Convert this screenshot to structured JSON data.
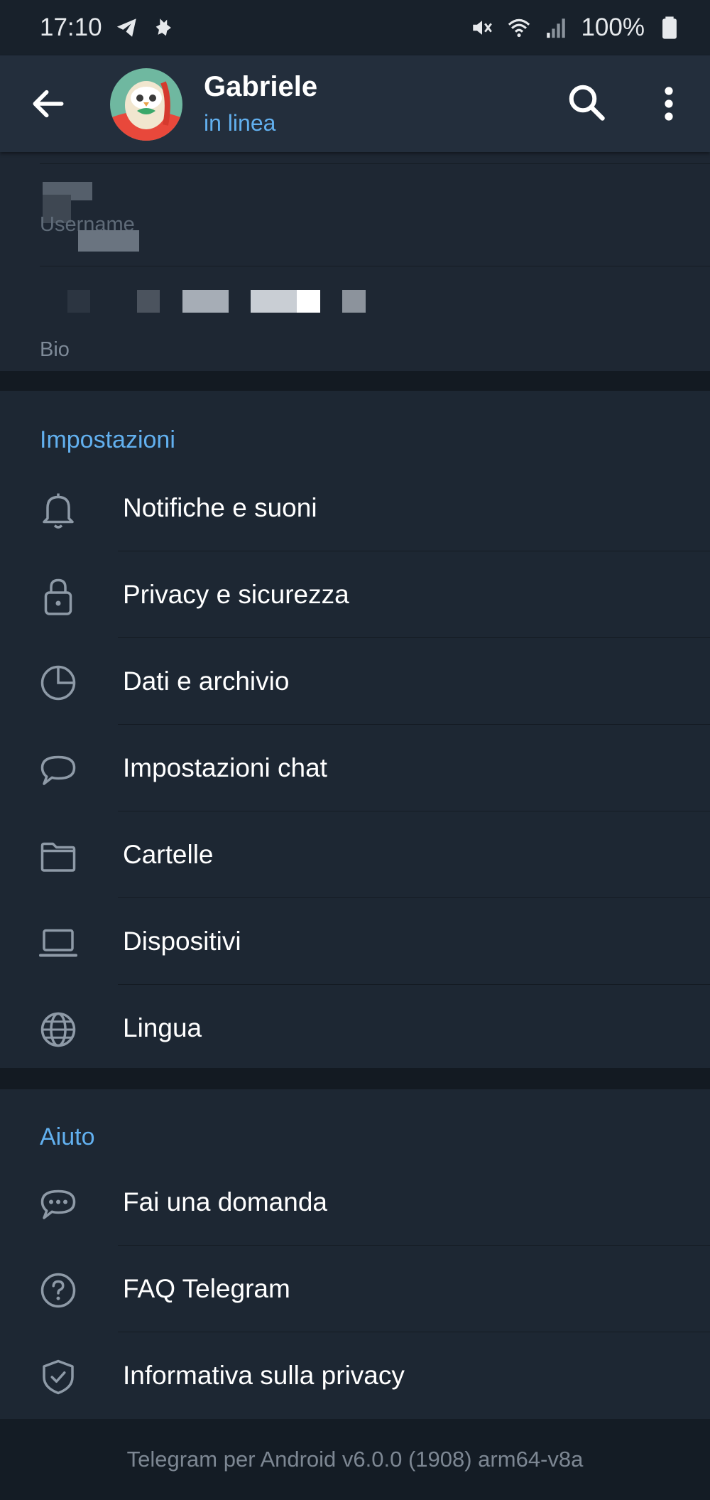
{
  "status_bar": {
    "time": "17:10",
    "battery": "100%"
  },
  "header": {
    "name": "Gabriele",
    "status": "in linea"
  },
  "profile_info": {
    "username_label": "Username",
    "bio_label": "Bio"
  },
  "settings_section": {
    "title": "Impostazioni",
    "items": [
      {
        "label": "Notifiche e suoni",
        "icon": "bell-icon"
      },
      {
        "label": "Privacy e sicurezza",
        "icon": "lock-icon"
      },
      {
        "label": "Dati e archivio",
        "icon": "pie-chart-icon"
      },
      {
        "label": "Impostazioni chat",
        "icon": "chat-bubble-icon"
      },
      {
        "label": "Cartelle",
        "icon": "folder-icon"
      },
      {
        "label": "Dispositivi",
        "icon": "laptop-icon"
      },
      {
        "label": "Lingua",
        "icon": "globe-icon"
      }
    ]
  },
  "help_section": {
    "title": "Aiuto",
    "items": [
      {
        "label": "Fai una domanda",
        "icon": "chat-dots-icon"
      },
      {
        "label": "FAQ Telegram",
        "icon": "question-icon"
      },
      {
        "label": "Informativa sulla privacy",
        "icon": "shield-check-icon"
      }
    ]
  },
  "footer": {
    "version": "Telegram per Android v6.0.0 (1908) arm64-v8a"
  },
  "colors": {
    "accent": "#62b0ef",
    "background": "#1d2733",
    "appbar": "#232e3c",
    "divider": "#141b23"
  }
}
